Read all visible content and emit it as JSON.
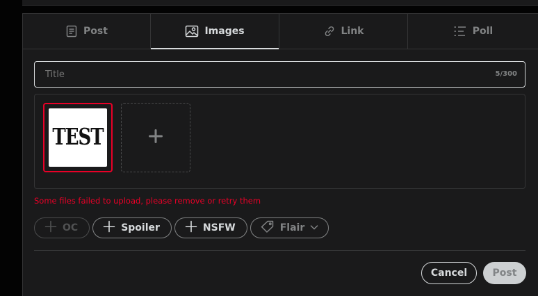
{
  "tabs": [
    {
      "label": "Post",
      "icon": "post-icon",
      "active": false
    },
    {
      "label": "Images",
      "icon": "image-icon",
      "active": true
    },
    {
      "label": "Link",
      "icon": "link-icon",
      "active": false
    },
    {
      "label": "Poll",
      "icon": "poll-icon",
      "active": false
    }
  ],
  "title_field": {
    "placeholder": "Title",
    "value": "",
    "counter": "5/300"
  },
  "upload": {
    "thumbnails": [
      {
        "image_text": "TEST",
        "status": "failed"
      }
    ],
    "add_icon": "plus-icon"
  },
  "error_message": "Some files failed to upload, please remove or retry them",
  "tags": {
    "oc": "OC",
    "spoiler": "Spoiler",
    "nsfw": "NSFW",
    "flair": "Flair"
  },
  "actions": {
    "cancel": "Cancel",
    "post": "Post"
  },
  "colors": {
    "background": "#1a1a1b",
    "border": "#343536",
    "text": "#d7dadc",
    "muted": "#818384",
    "error": "#ea0027"
  }
}
